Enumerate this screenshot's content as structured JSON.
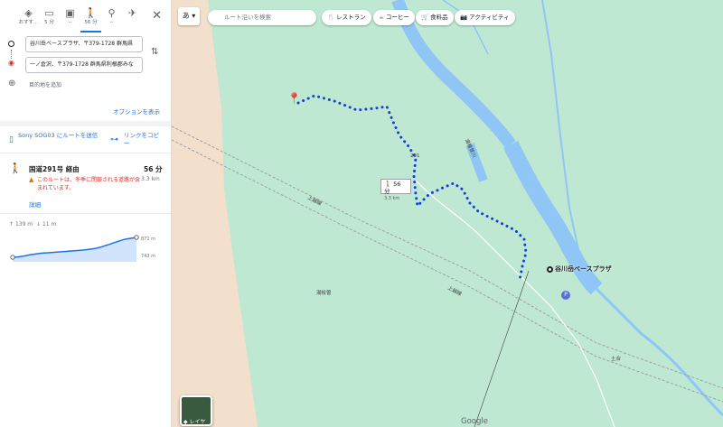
{
  "travel_modes": [
    {
      "name": "directions-icon",
      "icon": "◈",
      "label": "おすす…"
    },
    {
      "name": "car-icon",
      "icon": "▭",
      "label": "5 分"
    },
    {
      "name": "train-icon",
      "icon": "▣",
      "label": "--"
    },
    {
      "name": "walk-icon",
      "icon": "🚶",
      "label": "56 分"
    },
    {
      "name": "bike-icon",
      "icon": "⚲",
      "label": "--"
    },
    {
      "name": "flight-icon",
      "icon": "✈",
      "label": ""
    }
  ],
  "waypoints": {
    "origin": "谷川岳ベースプラザ、〒379-1728 群馬県",
    "destination": "一ノ倉沢、〒379-1728 群馬県利根郡みな",
    "add_label": "目的地を追加"
  },
  "options_label": "オプションを表示",
  "send_label": "Sony SOG03 にルートを送信",
  "copy_label": "リンクをコピー",
  "route": {
    "title": "国道291号 経由",
    "time": "56 分",
    "distance": "3.3 km",
    "warning": "このルートは、冬季に閉鎖される道路が含まれています。",
    "details_label": "詳細"
  },
  "elevation": {
    "up": "139 m",
    "down": "11 m",
    "max": "872 m",
    "min": "743 m",
    "profile": [
      743,
      746,
      752,
      760,
      765,
      770,
      772,
      775,
      778,
      781,
      784,
      787,
      790,
      795,
      800,
      810,
      822,
      835,
      848,
      860,
      866,
      872
    ]
  },
  "map": {
    "lang_label": "あ",
    "search_placeholder": "ルート沿いを検索",
    "chips": [
      {
        "icon": "🍴",
        "label": "レストラン"
      },
      {
        "icon": "☕",
        "label": "コーヒー"
      },
      {
        "icon": "🛒",
        "label": "食料品"
      },
      {
        "icon": "📷",
        "label": "アクティビティ"
      }
    ],
    "callout_time": "56 分",
    "callout_dist": "3.3 km",
    "place_name": "谷川岳ベースプラザ",
    "label_area": "湯桧曽",
    "label_rail_1": "上越線",
    "label_rail_2": "上越線",
    "label_river": "湯檜曽川",
    "label_road": "291",
    "label_place_2": "土合",
    "parking_label": "P",
    "layer_label": "レイヤ",
    "logo": "Google",
    "colors": {
      "route": "#1a3fd6",
      "water": "#8fc6f5",
      "land": "#bfe8d3",
      "bare": "#f3e0cc"
    }
  }
}
